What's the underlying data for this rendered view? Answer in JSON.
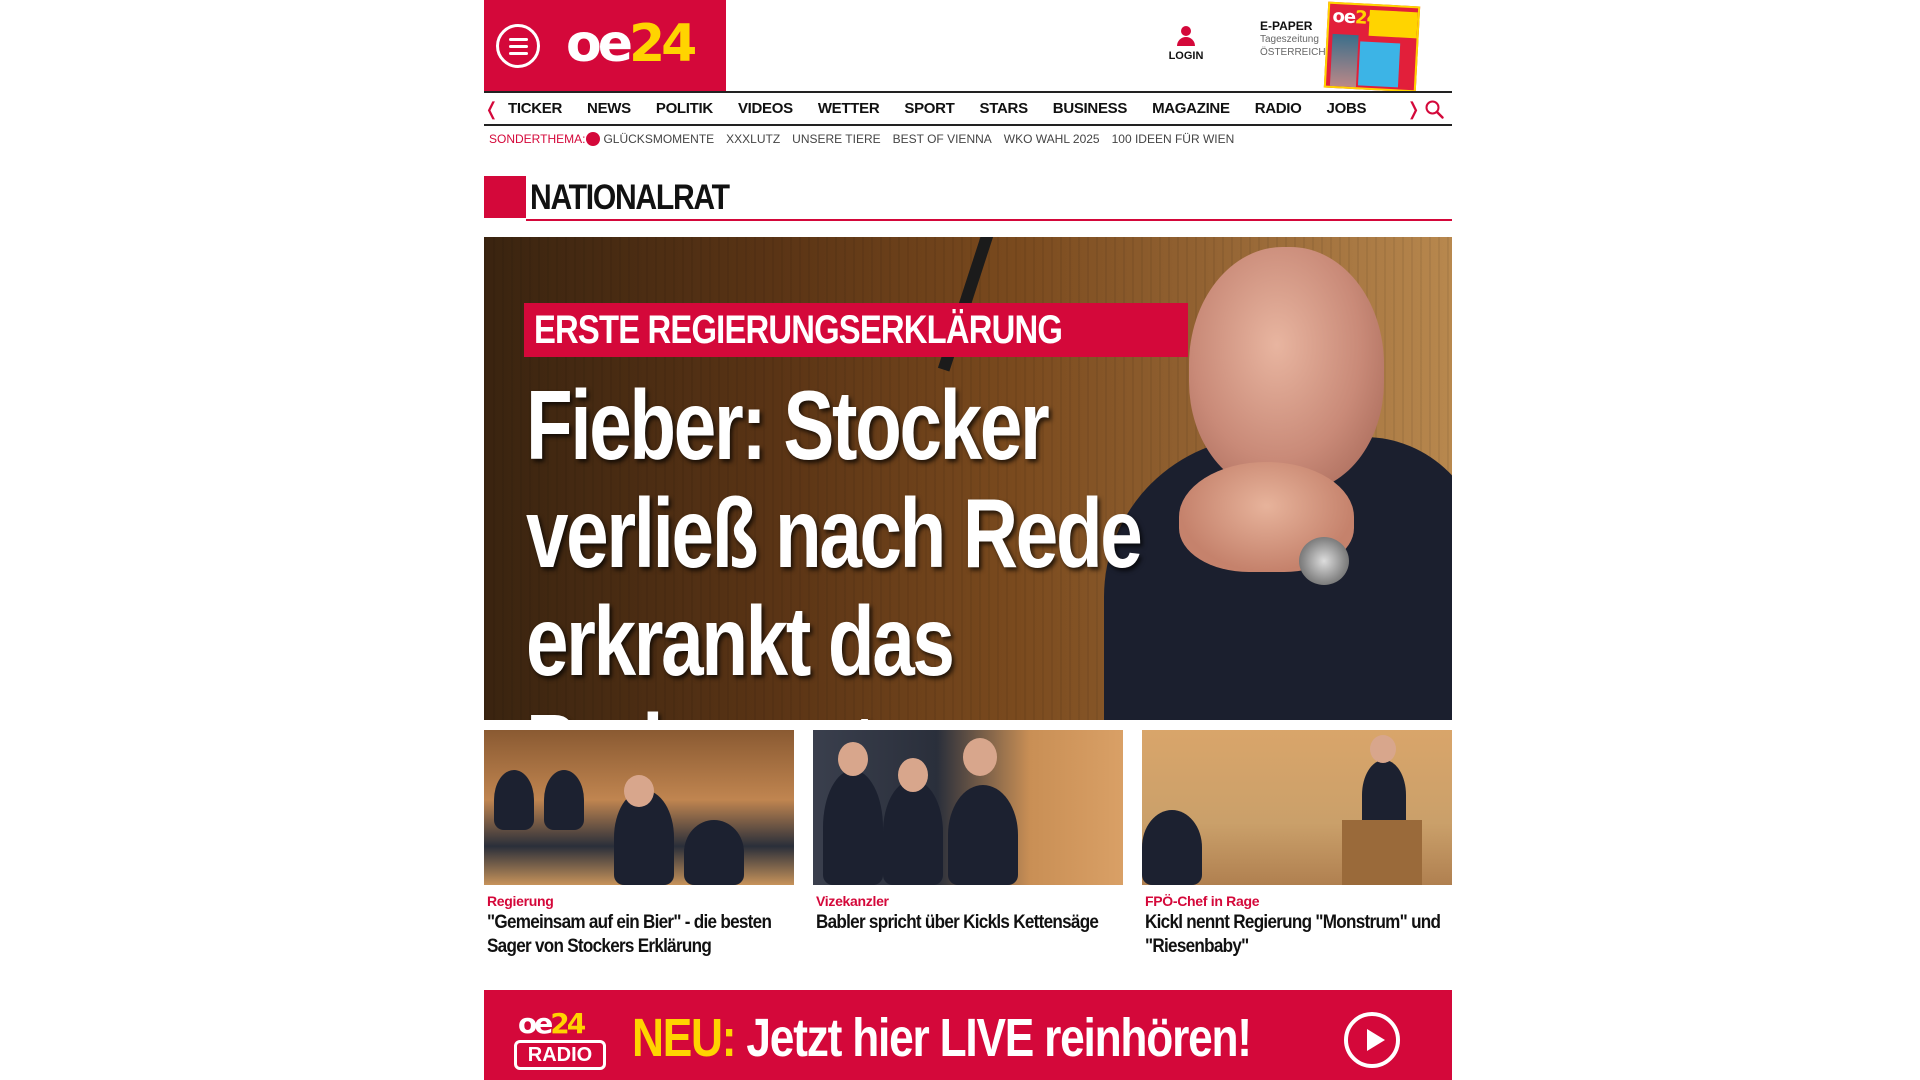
{
  "brand": {
    "logo_oe": "oe",
    "logo_24": "24",
    "primary_color": "#d4083a",
    "accent_color": "#ffd400"
  },
  "header": {
    "login_label": "LOGIN",
    "epaper_title": "E-PAPER",
    "epaper_sub1": "Tageszeitung",
    "epaper_sub2": "ÖSTERREICH"
  },
  "nav": {
    "items": [
      "TICKER",
      "NEWS",
      "POLITIK",
      "VIDEOS",
      "WETTER",
      "SPORT",
      "STARS",
      "BUSINESS",
      "MAGAZINE",
      "RADIO",
      "JOBS"
    ],
    "prev_icon": "chevron-left-icon",
    "next_icon": "chevron-right-icon"
  },
  "subnav": {
    "label": "SONDERTHEMA:",
    "items": [
      "GLÜCKSMOMENTE",
      "XXXLUTZ",
      "UNSERE TIERE",
      "BEST OF VIENNA",
      "WKO WAHL 2025",
      "100 IDEEN FÜR WIEN"
    ]
  },
  "section": {
    "title": "NATIONALRAT"
  },
  "hero": {
    "kicker": "ERSTE REGIERUNGSERKLÄRUNG",
    "title_line1": "Fieber: Stocker",
    "title_line2": "verließ nach Rede",
    "title_line3": "erkrankt das Parlament"
  },
  "teasers": [
    {
      "kicker": "Regierung",
      "title": "\"Gemeinsam auf ein Bier\" - die besten Sager von Stockers Erklärung"
    },
    {
      "kicker": "Vizekanzler",
      "title": "Babler spricht über Kickls Kettensäge"
    },
    {
      "kicker": "FPÖ-Chef in Rage",
      "title": "Kickl nennt Regierung \"Monstrum\" und \"Riesenbaby\""
    }
  ],
  "radio": {
    "logo_oe": "oe",
    "logo_24": "24",
    "logo_label": "RADIO",
    "neu": "NEU:",
    "text": "Jetzt hier LIVE reinhören!"
  }
}
